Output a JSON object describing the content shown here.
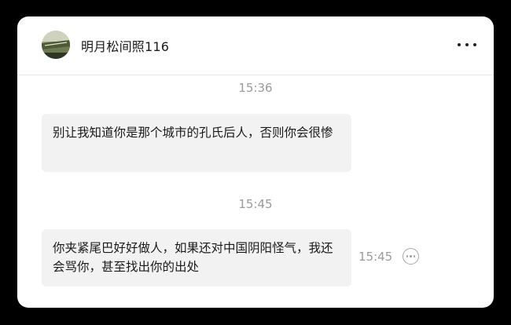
{
  "contact": {
    "name": "明月松间照116"
  },
  "header": {
    "more_icon": "more-horizontal-icon"
  },
  "messages": [
    {
      "time_divider": "15:36",
      "text": "别让我知道你是那个城市的孔氏后人，否则你会很惨"
    },
    {
      "time_divider": "15:45",
      "text": "你夹紧尾巴好好做人，如果还对中国阴阳怪气，我还会骂你，甚至找出你的出处",
      "side_time": "15:45",
      "side_action_icon": "more-circle-icon"
    }
  ],
  "colors": {
    "background": "#000000",
    "card": "#ffffff",
    "bubble": "#f2f2f2",
    "muted_text": "#9a9a9a"
  }
}
